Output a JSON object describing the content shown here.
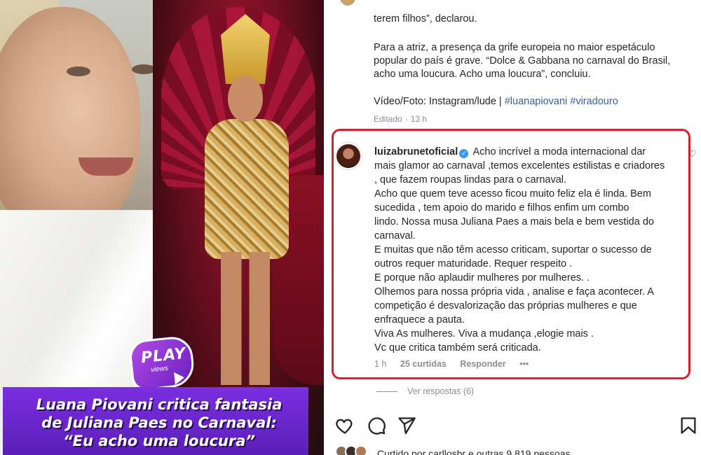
{
  "media": {
    "logo_word": "PLAY",
    "logo_sub": "views",
    "headline_lines": [
      "Luana Piovani critica fantasia",
      "de Juliana Paes no Carnaval:",
      "“Eu acho uma loucura”"
    ]
  },
  "caption": {
    "top_line": "terem filhos”, declarou.",
    "paragraph_lines": [
      "Para a atriz, a presença da grife europeia no maior espetáculo",
      "popular do país é grave. “Dolce & Gabbana no carnaval do Brasil,",
      "acho uma loucura. Acho uma loucura”, concluiu."
    ],
    "video_prefix": "Vídeo/Foto: Instagram/lude | ",
    "hashtags": "#luanapiovani #viradouro",
    "edited_label": "Editado",
    "edited_time": "13 h"
  },
  "comment": {
    "username": "luizabrunetoficial",
    "lines": [
      "Acho incrível a moda internacional dar",
      "mais glamor ao carnaval ,temos excelentes estilistas e criadores",
      ", que fazem roupas lindas para o carnaval.",
      "Acho que quem teve acesso ficou muito feliz ela é linda. Bem",
      "sucedida , tem apoio do marido e filhos enfim um combo",
      "lindo. Nossa musa Juliana Paes a mais bela e bem vestida do",
      "carnaval.",
      "E muitas que não têm acesso criticam, suportar o sucesso de",
      "outros requer maturidade. Requer respeito .",
      "E porque não aplaudir mulheres por mulheres. .",
      "Olhemos para nossa própria vida , analise e faça acontecer. A",
      "competição é desvalorização das próprias mulheres e que",
      "enfraquece a pauta.",
      "Viva As mulheres. Viva a mudança ,elogie mais .",
      "Vc que critica também será criticada."
    ],
    "time": "1 h",
    "likes": "25 curtidas",
    "reply_label": "Responder",
    "more_label": "•••",
    "view_replies": "Ver respostas (6)"
  },
  "footer": {
    "liked_by": "Curtido por carllosbr e outras 9.819 pessoas"
  },
  "colors": {
    "highlight_frame": "#d81f2a",
    "hashtag": "#3b5ca8",
    "headline_bg": "#5a1fb8",
    "verified": "#3897f0"
  }
}
